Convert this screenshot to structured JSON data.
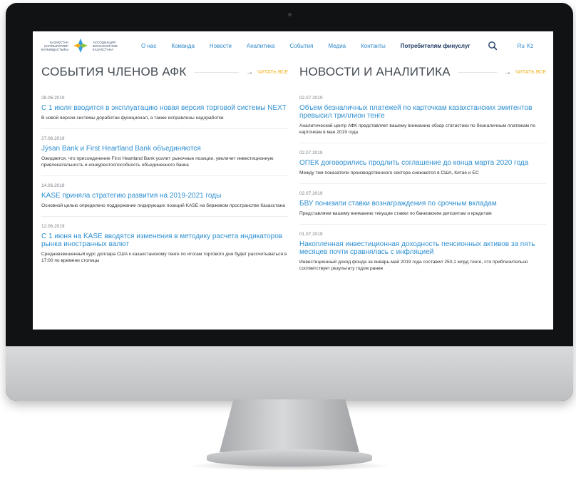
{
  "header": {
    "logo_text_left": "Қазақстан Қаржыгерлер Қауымдастығы",
    "logo_text_right": "Ассоциация финансистов Казахстана",
    "nav": [
      "О нас",
      "Команда",
      "Новости",
      "Аналитика",
      "События",
      "Медиа",
      "Контакты"
    ],
    "nav_highlight": "Потребителям финуслуг",
    "lang_ru": "Ru",
    "lang_kz": "Kz"
  },
  "left_column": {
    "title": "СОБЫТИЯ ЧЛЕНОВ АФК",
    "read_all": "ЧИТАТЬ ВСЕ",
    "items": [
      {
        "date": "28.06.2019",
        "title": "С 1 июля вводится в эксплуатацию новая версия торговой системы NEXT",
        "desc": "В новой версии системы доработан функционал, а также исправлены недоработки"
      },
      {
        "date": "27.06.2019",
        "title": "Jýsan Bank и First Heartland Bank объединяются",
        "desc": "Ожидается, что присоединение First Heartland Bank усилит рыночные позиции, увеличит инвестиционную привлекательность и конкурентоспособность объединенного банка"
      },
      {
        "date": "14.06.2019",
        "title": "KASE приняла стратегию развития на 2019-2021 годы",
        "desc": "Основной целью определено поддержание лидирующих позиций KASE на биржевом пространстве Казахстана"
      },
      {
        "date": "12.06.2019",
        "title": "С 1 июня на KASE вводятся изменения в методику расчета индикаторов рынка иностранных валют",
        "desc": "Средневзвешенный курс доллара США к казахстанскому тенге по итогам торгового дня будет рассчитываться в 17:00 по времени столицы"
      }
    ]
  },
  "right_column": {
    "title": "НОВОСТИ И АНАЛИТИКА",
    "read_all": "ЧИТАТЬ ВСЕ",
    "items": [
      {
        "date": "02.07.2019",
        "title": "Объем безналичных платежей по карточкам казахстанских эмитентов превысил триллион тенге",
        "desc": "Аналитический центр АФК представляет вашему вниманию обзор статистики по безналичным платежам по карточкам в мае 2019 года"
      },
      {
        "date": "02.07.2019",
        "title": "ОПЕК договорились продлить соглашение до конца марта 2020 года",
        "desc": "Между тем показатели производственного сектора снижаются в США, Китае и ЕС"
      },
      {
        "date": "02.07.2019",
        "title": "БВУ понизили ставки вознаграждения по срочным вкладам",
        "desc": "Представляем вашему вниманию текущие ставки по банковским депозитам и кредитам"
      },
      {
        "date": "01.07.2019",
        "title": "Накопленная инвестиционная доходность пенсионных активов за пять месяцев почти сравнялась с инфляцией",
        "desc": "Инвестиционный доход фонда за январь-май 2019 года составил 250,1 млрд тенге, что приблизительно соответствует результату годом ранее"
      }
    ]
  },
  "colors": {
    "link": "#2e8fd1",
    "accent": "#f2b01e",
    "heading": "#444b52"
  },
  "icons": [
    "search-icon",
    "arrow-right-icon",
    "logo-icon"
  ]
}
